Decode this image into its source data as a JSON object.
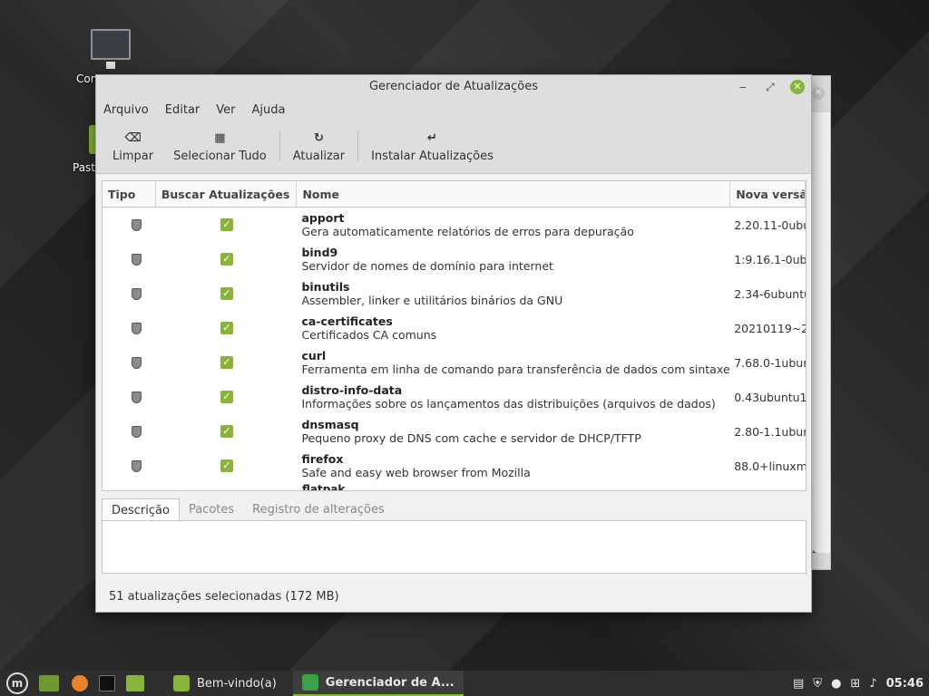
{
  "desktop": {
    "icons": [
      {
        "label": "Com",
        "icon": "computer-icon"
      },
      {
        "label": "Past",
        "icon": "folder-icon"
      }
    ]
  },
  "background_window": {
    "text": "t."
  },
  "window": {
    "title": "Gerenciador de Atualizações",
    "controls": {
      "minimize": "‒",
      "maximize": "⤢",
      "close": "✕"
    }
  },
  "menu": [
    "Arquivo",
    "Editar",
    "Ver",
    "Ajuda"
  ],
  "toolbar": {
    "clear": {
      "label": "Limpar",
      "icon": "backspace-icon"
    },
    "select_all": {
      "label": "Selecionar Tudo",
      "icon": "select-all-icon"
    },
    "refresh": {
      "label": "Atualizar",
      "icon": "refresh-icon"
    },
    "install": {
      "label": "Instalar Atualizações",
      "icon": "install-arrow-icon"
    }
  },
  "table": {
    "headers": [
      "Tipo",
      "Buscar Atualizações",
      "Nome",
      "Nova versão"
    ],
    "rows": [
      {
        "name": "apport",
        "desc": "Gera automaticamente relatórios de erros para depuração",
        "version": "2.20.11-0ubu"
      },
      {
        "name": "bind9",
        "desc": "Servidor de nomes de domínio para internet",
        "version": "1:9.16.1-0ub"
      },
      {
        "name": "binutils",
        "desc": "Assembler, linker e utilitários binários da GNU",
        "version": "2.34-6ubuntu"
      },
      {
        "name": "ca-certificates",
        "desc": "Certificados CA comuns",
        "version": "20210119~2"
      },
      {
        "name": "curl",
        "desc": "Ferramenta em linha de comando para transferência de dados com sintaxe URL",
        "version": "7.68.0-1ubur"
      },
      {
        "name": "distro-info-data",
        "desc": "Informações sobre os lançamentos das distribuições (arquivos de dados)",
        "version": "0.43ubuntu1"
      },
      {
        "name": "dnsmasq",
        "desc": "Pequeno proxy de DNS com cache e servidor de DHCP/TFTP",
        "version": "2.80-1.1ubur"
      },
      {
        "name": "firefox",
        "desc": "Safe and easy web browser from Mozilla",
        "version": "88.0+linuxmi"
      }
    ],
    "partial_row": "flatpak"
  },
  "tabs": [
    "Descrição",
    "Pacotes",
    "Registro de alterações"
  ],
  "status": "51 atualizações selecionadas (172 MB)",
  "taskbar": {
    "tasks": [
      {
        "label": "Bem-vindo(a)",
        "color": "#8ab33c"
      },
      {
        "label": "Gerenciador de A...",
        "color": "#3aa04a"
      }
    ],
    "clock": "05:46"
  },
  "colors": {
    "accent": "#8ab33c"
  }
}
